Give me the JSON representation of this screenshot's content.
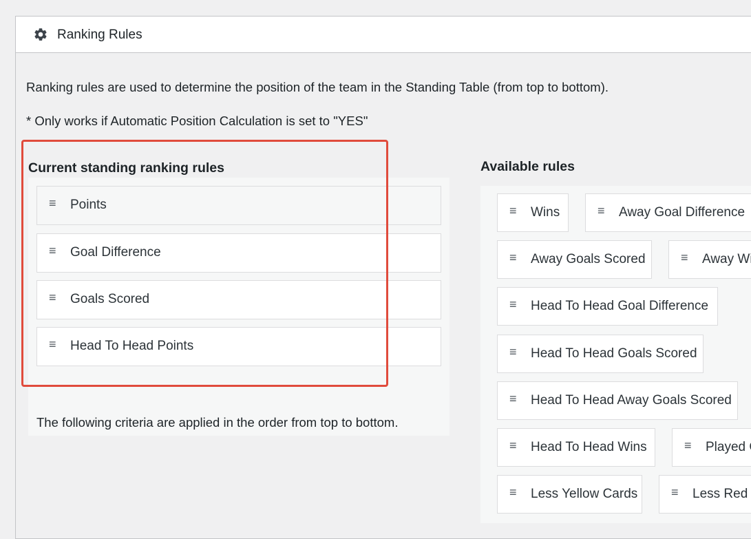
{
  "panel": {
    "title": "Ranking Rules",
    "icon": "gear-icon"
  },
  "description": {
    "line1": "Ranking rules are used to determine the position of the team in the Standing Table (from top to bottom).",
    "line2": "* Only works if Automatic Position Calculation is set to \"YES\""
  },
  "current": {
    "title": "Current standing ranking rules",
    "rules": [
      "Points",
      "Goal Difference",
      "Goals Scored",
      "Head To Head Points"
    ],
    "hint": "The following criteria are applied in the order from top to bottom."
  },
  "available": {
    "title": "Available rules",
    "rules": [
      "Wins",
      "Away Goal Difference",
      "Away Goals Scored",
      "Away Wins",
      "Head To Head Goal Difference",
      "Head To Head Goals Scored",
      "Head To Head Away Goals Scored",
      "Head To Head Wins",
      "Played Games",
      "Less Yellow Cards",
      "Less Red Cards"
    ]
  },
  "handle_glyph": "≡",
  "colors": {
    "highlight": "#e04b3c",
    "background": "#f0f0f1"
  }
}
